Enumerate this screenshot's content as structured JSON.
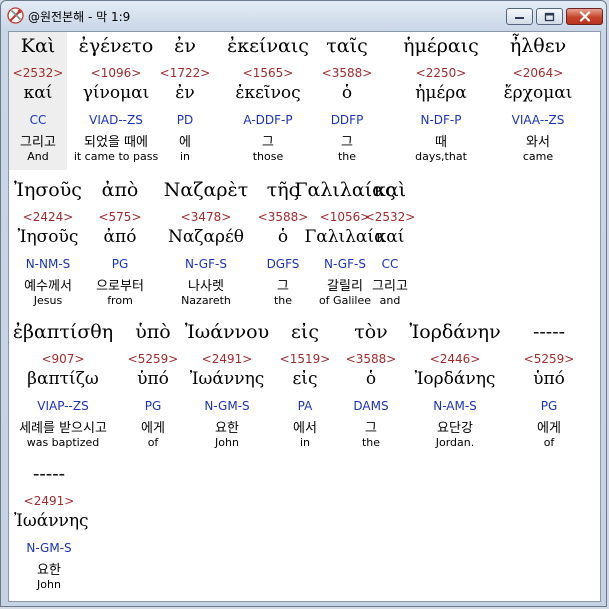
{
  "window": {
    "title": "@원전본해 - 막 1:9",
    "icon": "app-tools-icon",
    "buttons": [
      "minimize",
      "maximize",
      "close"
    ]
  },
  "colors": {
    "strongs_number": "#a52a2a",
    "parse_code": "#1a34c2",
    "text": "#000000",
    "selected_background": "#eeeeee"
  },
  "rows": [
    {
      "words": [
        {
          "greek": "Καὶ",
          "strongs": "<2532>",
          "lexical": "καί",
          "parse": "CC",
          "korean": "그리고",
          "english": "And",
          "selected": true
        },
        {
          "greek": "ἐγένετο",
          "strongs": "<1096>",
          "lexical": "γίνομαι",
          "parse": "VIAD--ZS",
          "korean": "되었을 때에",
          "english": "it came to pass"
        },
        {
          "greek": "ἐν",
          "strongs": "<1722>",
          "lexical": "ἐν",
          "parse": "PD",
          "korean": "에",
          "english": "in"
        },
        {
          "greek": "ἐκείναις",
          "strongs": "<1565>",
          "lexical": "ἐκεῖνος",
          "parse": "A-DDF-P",
          "korean": "그",
          "english": "those"
        },
        {
          "greek": "ταῖς",
          "strongs": "<3588>",
          "lexical": "ὁ",
          "parse": "DDFP",
          "korean": "그",
          "english": "the"
        },
        {
          "greek": "ἡμέραις",
          "strongs": "<2250>",
          "lexical": "ἡμέρα",
          "parse": "N-DF-P",
          "korean": "때",
          "english": "days,that"
        },
        {
          "greek": "ἦλθεν",
          "strongs": "<2064>",
          "lexical": "ἔρχομαι",
          "parse": "VIAA--ZS",
          "korean": "와서",
          "english": "came"
        }
      ]
    },
    {
      "words": [
        {
          "greek": "Ἰησοῦς",
          "strongs": "<2424>",
          "lexical": "Ἰησοῦς",
          "parse": "N-NM-S",
          "korean": "예수께서",
          "english": "Jesus"
        },
        {
          "greek": "ἀπὸ",
          "strongs": "<575>",
          "lexical": "ἀπό",
          "parse": "PG",
          "korean": "으로부터",
          "english": "from"
        },
        {
          "greek": "Ναζαρὲτ",
          "strongs": "<3478>",
          "lexical": "Ναζαρέθ",
          "parse": "N-GF-S",
          "korean": "나사렛",
          "english": "Nazareth"
        },
        {
          "greek": "τῆς",
          "strongs": "<3588>",
          "lexical": "ὁ",
          "parse": "DGFS",
          "korean": "그",
          "english": "the"
        },
        {
          "greek": "Γαλιλαίας",
          "strongs": "<1056>",
          "lexical": "Γαλιλαία",
          "parse": "N-GF-S",
          "korean": "갈릴리",
          "english": "of Galilee"
        },
        {
          "greek": "καὶ",
          "strongs": "<2532>",
          "lexical": "καί",
          "parse": "CC",
          "korean": "그리고",
          "english": "and"
        }
      ]
    },
    {
      "words": [
        {
          "greek": "ἐβαπτίσθη",
          "strongs": "<907>",
          "lexical": "βαπτίζω",
          "parse": "VIAP--ZS",
          "korean": "세례를 받으시고",
          "english": "was baptized"
        },
        {
          "greek": "ὑπὸ",
          "strongs": "<5259>",
          "lexical": "ὑπό",
          "parse": "PG",
          "korean": "에게",
          "english": "of"
        },
        {
          "greek": "Ἰωάννου",
          "strongs": "<2491>",
          "lexical": "Ἰωάννης",
          "parse": "N-GM-S",
          "korean": "요한",
          "english": "John"
        },
        {
          "greek": "εἰς",
          "strongs": "<1519>",
          "lexical": "εἰς",
          "parse": "PA",
          "korean": "에서",
          "english": "in"
        },
        {
          "greek": "τὸν",
          "strongs": "<3588>",
          "lexical": "ὁ",
          "parse": "DAMS",
          "korean": "그",
          "english": "the"
        },
        {
          "greek": "Ἰορδάνην",
          "strongs": "<2446>",
          "lexical": "Ἰορδάνης",
          "parse": "N-AM-S",
          "korean": "요단강",
          "english": "Jordan."
        },
        {
          "greek": "-----",
          "strongs": "<5259>",
          "lexical": "ὑπό",
          "parse": "PG",
          "korean": "에게",
          "english": "of"
        }
      ]
    },
    {
      "words": [
        {
          "greek": "-----",
          "strongs": "<2491>",
          "lexical": "Ἰωάννης",
          "parse": "N-GM-S",
          "korean": "요한",
          "english": "John"
        }
      ]
    }
  ]
}
